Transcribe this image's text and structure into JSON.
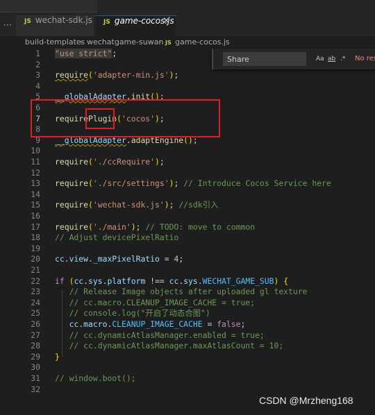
{
  "tabs": [
    {
      "label": "wechat-sdk.js",
      "icon": "JS"
    },
    {
      "label": "game-cocos.js",
      "icon": "JS",
      "close": "✕"
    }
  ],
  "tab_overflow": "⋯",
  "breadcrumb": {
    "items": [
      "build-templates",
      "wechatgame-suwan",
      "game-cocos.js"
    ],
    "separator": "›",
    "file_icon": "JS"
  },
  "find": {
    "value": "Share",
    "options": [
      "Aa",
      "ab",
      ".*"
    ],
    "status": "No results"
  },
  "code": {
    "line_numbers": [
      "1",
      "2",
      "3",
      "4",
      "5",
      "6",
      "7",
      "8",
      "9",
      "10",
      "11",
      "12",
      "13",
      "14",
      "15",
      "16",
      "17",
      "18",
      "19",
      "20",
      "21",
      "22",
      "23",
      "24",
      "25",
      "26",
      "27",
      "28",
      "29",
      "30",
      "31",
      "32"
    ],
    "current_line": "7",
    "lines": [
      [
        {
          "t": "\"use strict\"",
          "c": "str hl-str"
        },
        {
          "t": ";",
          "c": "pl"
        }
      ],
      [],
      [
        {
          "t": "require",
          "c": "fn squiggle"
        },
        {
          "t": "(",
          "c": "br"
        },
        {
          "t": "'adapter-min.js'",
          "c": "str"
        },
        {
          "t": ")",
          "c": "br"
        },
        {
          "t": ";",
          "c": "pl"
        }
      ],
      [],
      [
        {
          "t": "__globalAdapter",
          "c": "var squiggle"
        },
        {
          "t": ".",
          "c": "pl"
        },
        {
          "t": "init",
          "c": "fn"
        },
        {
          "t": "()",
          "c": "br"
        },
        {
          "t": ";",
          "c": "pl"
        }
      ],
      [],
      [
        {
          "t": "requirePlugin",
          "c": "fn"
        },
        {
          "t": "(",
          "c": "br"
        },
        {
          "t": "'cocos'",
          "c": "str"
        },
        {
          "t": ")",
          "c": "br"
        },
        {
          "t": ";",
          "c": "pl"
        }
      ],
      [],
      [
        {
          "t": "__globalAdapter",
          "c": "var squiggle"
        },
        {
          "t": ".",
          "c": "pl"
        },
        {
          "t": "adaptEngine",
          "c": "fn"
        },
        {
          "t": "()",
          "c": "br"
        },
        {
          "t": ";",
          "c": "pl"
        }
      ],
      [],
      [
        {
          "t": "require",
          "c": "fn"
        },
        {
          "t": "(",
          "c": "br"
        },
        {
          "t": "'./ccRequire'",
          "c": "str"
        },
        {
          "t": ")",
          "c": "br"
        },
        {
          "t": ";",
          "c": "pl"
        }
      ],
      [],
      [
        {
          "t": "require",
          "c": "fn"
        },
        {
          "t": "(",
          "c": "br"
        },
        {
          "t": "'./src/settings'",
          "c": "str"
        },
        {
          "t": ")",
          "c": "br"
        },
        {
          "t": "; ",
          "c": "pl"
        },
        {
          "t": "// Introduce Cocos Service here",
          "c": "cm"
        }
      ],
      [],
      [
        {
          "t": "require",
          "c": "fn"
        },
        {
          "t": "(",
          "c": "br"
        },
        {
          "t": "'wechat-sdk.js'",
          "c": "str"
        },
        {
          "t": ")",
          "c": "br"
        },
        {
          "t": "; ",
          "c": "pl"
        },
        {
          "t": "//sdk引入",
          "c": "cm"
        }
      ],
      [],
      [
        {
          "t": "require",
          "c": "fn"
        },
        {
          "t": "(",
          "c": "br"
        },
        {
          "t": "'./main'",
          "c": "str"
        },
        {
          "t": ")",
          "c": "br"
        },
        {
          "t": "; ",
          "c": "pl"
        },
        {
          "t": "// TODO: move to common",
          "c": "cm"
        }
      ],
      [
        {
          "t": "// Adjust devicePixelRatio",
          "c": "cm"
        }
      ],
      [],
      [
        {
          "t": "cc",
          "c": "var"
        },
        {
          "t": ".",
          "c": "pl"
        },
        {
          "t": "view",
          "c": "var"
        },
        {
          "t": ".",
          "c": "pl"
        },
        {
          "t": "_maxPixelRatio",
          "c": "var"
        },
        {
          "t": " = ",
          "c": "pl"
        },
        {
          "t": "4",
          "c": "num"
        },
        {
          "t": ";",
          "c": "pl"
        }
      ],
      [],
      [
        {
          "t": "if",
          "c": "kw"
        },
        {
          "t": " ",
          "c": "pl"
        },
        {
          "t": "(",
          "c": "br"
        },
        {
          "t": "cc",
          "c": "var"
        },
        {
          "t": ".",
          "c": "pl"
        },
        {
          "t": "sys",
          "c": "var"
        },
        {
          "t": ".",
          "c": "pl"
        },
        {
          "t": "platform",
          "c": "var"
        },
        {
          "t": " !== ",
          "c": "pl"
        },
        {
          "t": "cc",
          "c": "var"
        },
        {
          "t": ".",
          "c": "pl"
        },
        {
          "t": "sys",
          "c": "var"
        },
        {
          "t": ".",
          "c": "pl"
        },
        {
          "t": "WECHAT_GAME_SUB",
          "c": "cst"
        },
        {
          "t": ")",
          "c": "br"
        },
        {
          "t": " ",
          "c": "pl"
        },
        {
          "t": "{",
          "c": "br"
        }
      ],
      [
        {
          "t": "   // Release Image objects after uploaded gl texture",
          "c": "cm"
        }
      ],
      [
        {
          "t": "   // cc.macro.CLEANUP_IMAGE_CACHE = true;",
          "c": "cm"
        }
      ],
      [
        {
          "t": "   // console.log(\"开启了动态合图\")",
          "c": "cm"
        }
      ],
      [
        {
          "t": "   cc",
          "c": "var"
        },
        {
          "t": ".",
          "c": "pl"
        },
        {
          "t": "macro",
          "c": "var"
        },
        {
          "t": ".",
          "c": "pl"
        },
        {
          "t": "CLEANUP_IMAGE_CACHE",
          "c": "cst"
        },
        {
          "t": " = ",
          "c": "pl"
        },
        {
          "t": "false",
          "c": "kw"
        },
        {
          "t": ";",
          "c": "pl"
        }
      ],
      [
        {
          "t": "   // cc.dynamicAtlasManager.enabled = true;",
          "c": "cm"
        }
      ],
      [
        {
          "t": "   // cc.dynamicAtlasManager.maxAtlasCount = 10;",
          "c": "cm"
        }
      ],
      [
        {
          "t": "}",
          "c": "br"
        }
      ],
      [],
      [
        {
          "t": "// window.boot();",
          "c": "cm"
        }
      ],
      []
    ]
  },
  "watermark": "CSDN @Mrzheng168"
}
